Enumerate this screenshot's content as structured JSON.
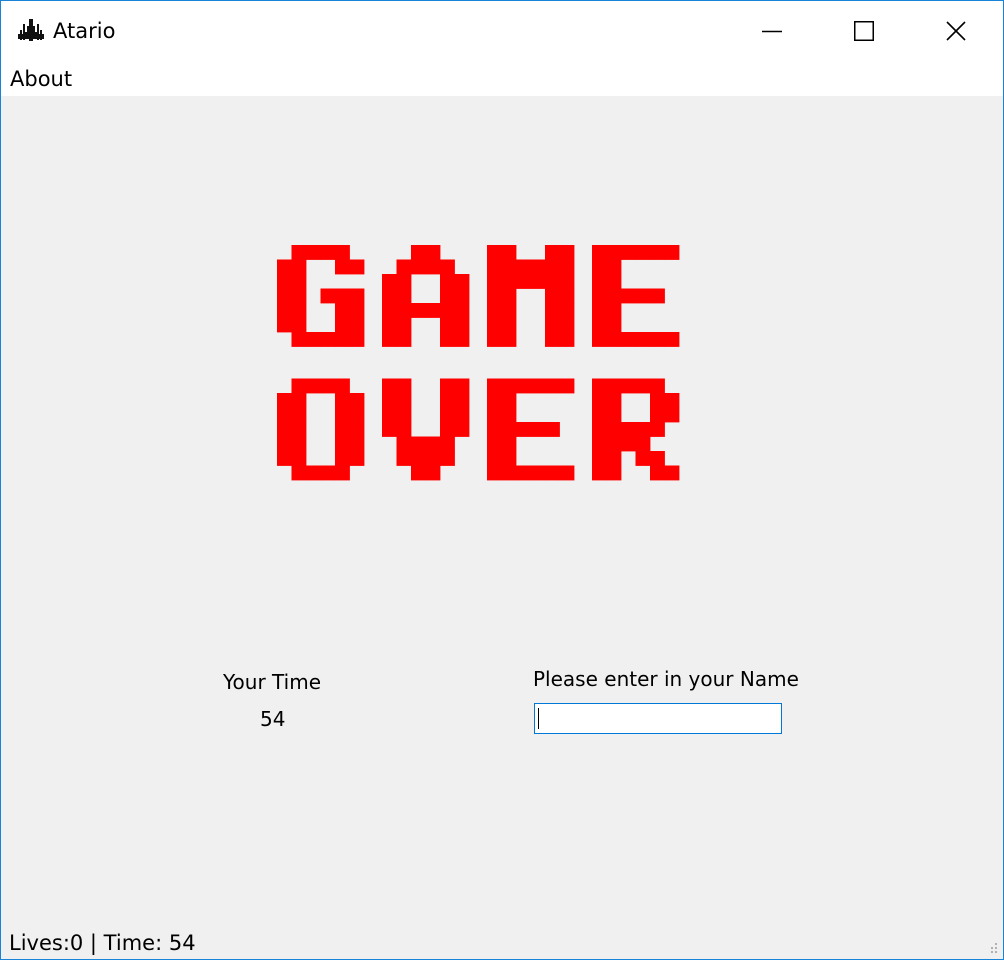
{
  "window": {
    "title": "Atario",
    "icon": "spaceship-icon",
    "controls": [
      "minimize-icon",
      "maximize-icon",
      "close-icon"
    ]
  },
  "menu": {
    "items": [
      {
        "label": "About"
      }
    ]
  },
  "game_over": {
    "line1": "GAME",
    "line2": "OVER",
    "color": "#ff0000"
  },
  "score": {
    "label": "Your Time",
    "value": "54"
  },
  "name_entry": {
    "label": "Please enter in your Name",
    "value": ""
  },
  "status": {
    "text": "Lives:0 | Time: 54"
  },
  "colors": {
    "accent": "#0078d7",
    "background": "#f0f0f0",
    "gameover": "#ff0000"
  }
}
